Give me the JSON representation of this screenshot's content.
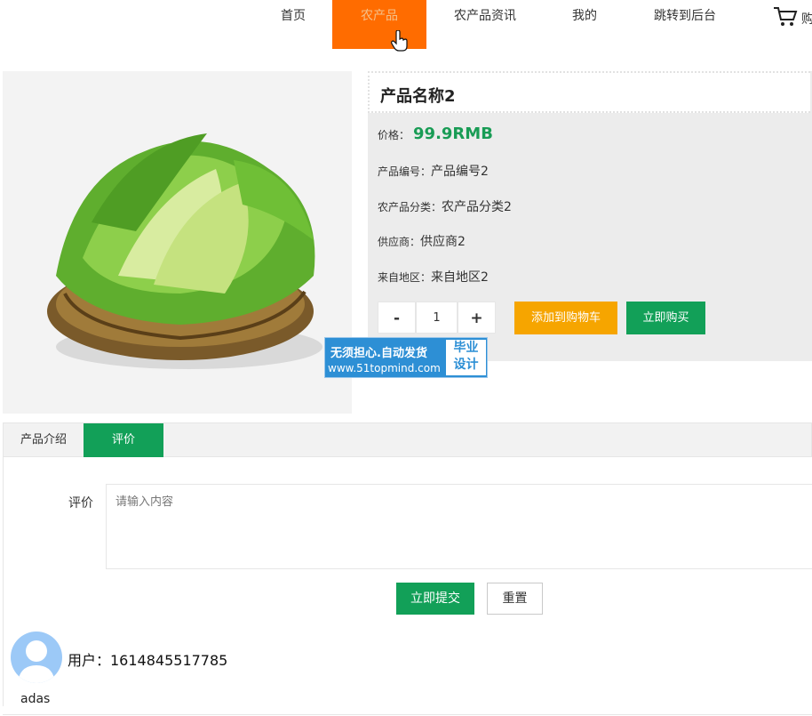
{
  "nav": {
    "items": [
      {
        "label": "首页"
      },
      {
        "label": "农产品"
      },
      {
        "label": "农产品资讯"
      },
      {
        "label": "我的"
      },
      {
        "label": "跳转到后台"
      }
    ],
    "cart_label": "购"
  },
  "product": {
    "name": "产品名称2",
    "price_label": "价格：",
    "price_value": "99.9RMB",
    "code_label": "产品编号：",
    "code_value": "产品编号2",
    "category_label": "农产品分类：",
    "category_value": "农产品分类2",
    "supplier_label": "供应商：",
    "supplier_value": "供应商2",
    "origin_label": "来自地区：",
    "origin_value": "来自地区2",
    "qty_minus": "-",
    "qty_value": "1",
    "qty_plus": "+",
    "add_cart": "添加到购物车",
    "buy_now": "立即购买"
  },
  "watermark": {
    "line1": "无须担心.自动发货",
    "line2": "www.51topmind.com",
    "box1": "毕业",
    "box2": "设计"
  },
  "tabs": [
    {
      "label": "产品介绍"
    },
    {
      "label": "评价"
    }
  ],
  "review_form": {
    "label": "评价",
    "placeholder": "请输入内容",
    "submit": "立即提交",
    "reset": "重置"
  },
  "comment": {
    "user": "用户：1614845517785",
    "text": "adas"
  },
  "colors": {
    "active_nav": "#ff6c00",
    "primary_green": "#12a058",
    "cart_orange": "#f6a500",
    "price_green": "#199c55"
  }
}
